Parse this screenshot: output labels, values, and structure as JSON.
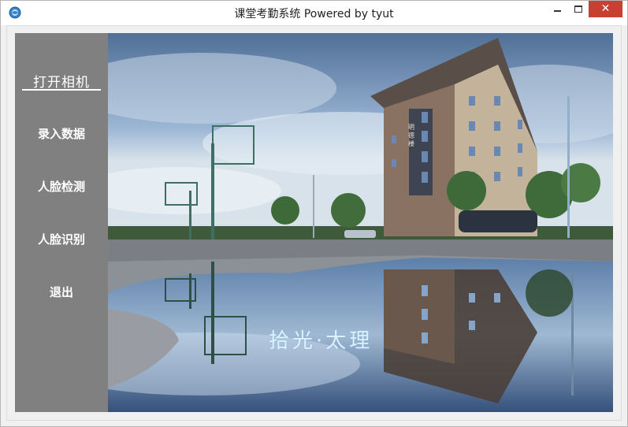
{
  "window": {
    "title": "课堂考勤系统 Powered by tyut",
    "icon": "app-globe-icon",
    "controls": {
      "close_glyph": "✕"
    }
  },
  "sidebar": {
    "items": [
      {
        "label": "打开相机",
        "active": true
      },
      {
        "label": "录入数据",
        "active": false
      },
      {
        "label": "人脸检测",
        "active": false
      },
      {
        "label": "人脸识别",
        "active": false
      },
      {
        "label": "退出",
        "active": false
      }
    ]
  },
  "display": {
    "overlay_text": "拾光·太理",
    "building_sign": "明 德 楼"
  },
  "colors": {
    "sidebar_bg": "#808080",
    "close_button": "#c84031",
    "sky": "#7b9cc2"
  }
}
